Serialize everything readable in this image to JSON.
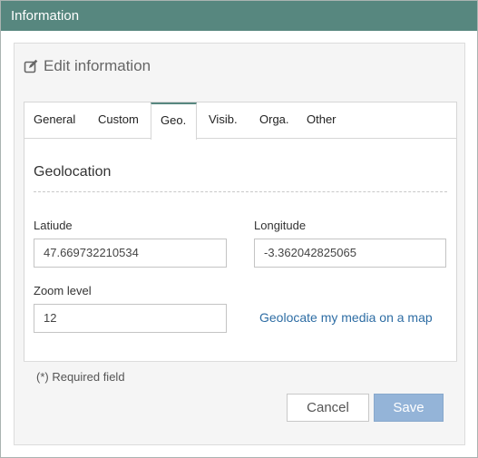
{
  "window": {
    "title": "Information"
  },
  "panel": {
    "header": "Edit information",
    "icon": "edit-icon"
  },
  "tabs": [
    {
      "label": "General",
      "active": false
    },
    {
      "label": "Custom",
      "active": false
    },
    {
      "label": "Geo.",
      "active": true
    },
    {
      "label": "Visib.",
      "active": false
    },
    {
      "label": "Orga.",
      "active": false
    },
    {
      "label": "Other",
      "active": false
    }
  ],
  "geo": {
    "section_title": "Geolocation",
    "latitude_label": "Latiude",
    "latitude_value": "47.669732210534",
    "longitude_label": "Longitude",
    "longitude_value": "-3.362042825065",
    "zoom_label": "Zoom level",
    "zoom_value": "12",
    "geolocate_link": "Geolocate my media on a map"
  },
  "footer": {
    "required_note": "(*) Required field",
    "cancel_label": "Cancel",
    "save_label": "Save"
  },
  "colors": {
    "titlebar": "#57877f",
    "link": "#2e6da4",
    "save_button": "#94b4d8"
  }
}
